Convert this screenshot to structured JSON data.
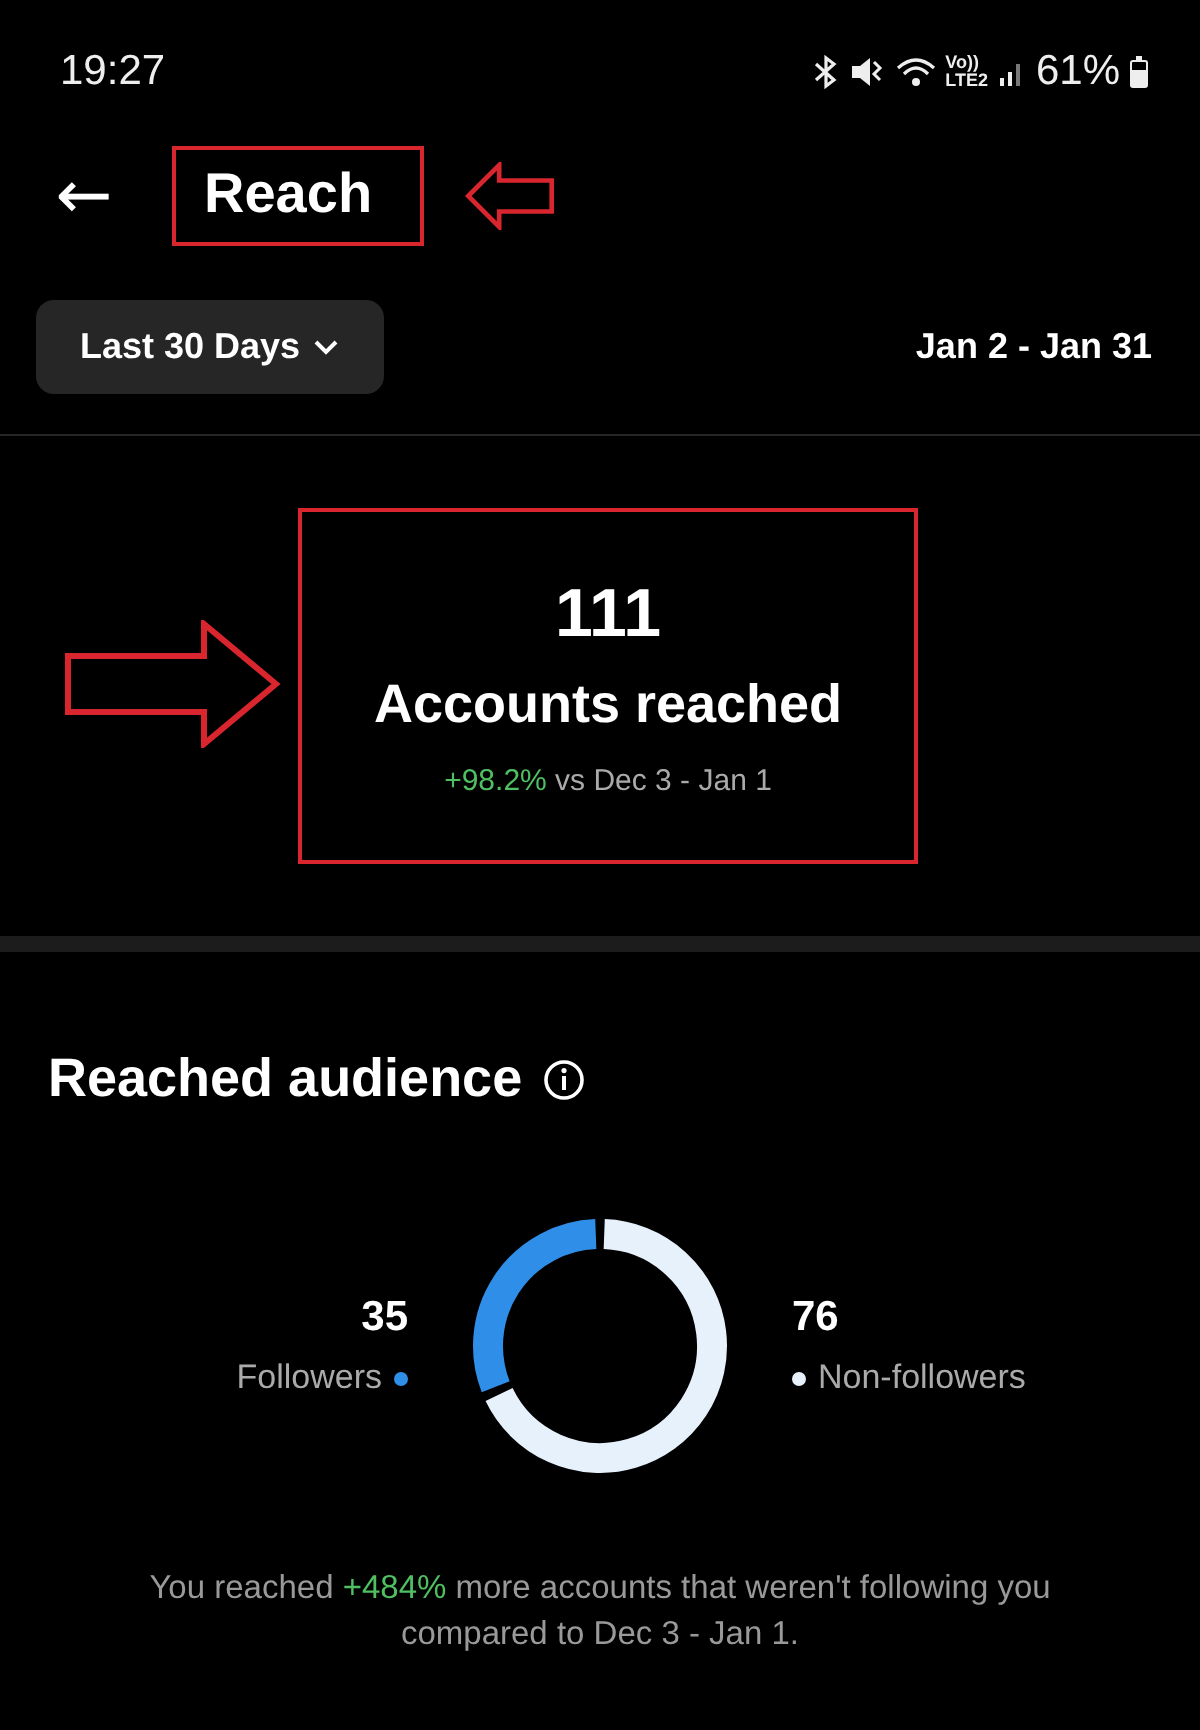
{
  "status_bar": {
    "time": "19:27",
    "volte": "Vo))",
    "network": "LTE2",
    "battery": "61%"
  },
  "header": {
    "title": "Reach",
    "back_label": "←"
  },
  "filter": {
    "range": "Last 30 Days",
    "dates": "Jan 2 - Jan 31"
  },
  "summary": {
    "value": "111",
    "label": "Accounts reached",
    "change": "+98.2%",
    "comparison": "vs Dec 3 - Jan 1"
  },
  "audience": {
    "title": "Reached audience",
    "legend": [
      {
        "value": "35",
        "label": "Followers",
        "color": "#2e8ee8"
      },
      {
        "value": "76",
        "label": "Non-followers",
        "color": "#e6f1fb"
      }
    ],
    "note": {
      "before": "You reached",
      "highlight": "+484%",
      "after": "more accounts that weren't following you compared to Dec 3 - Jan 1."
    }
  },
  "annotations": {
    "title_box": true,
    "title_arrow": true,
    "summary_box": true,
    "summary_arrow": true
  }
}
